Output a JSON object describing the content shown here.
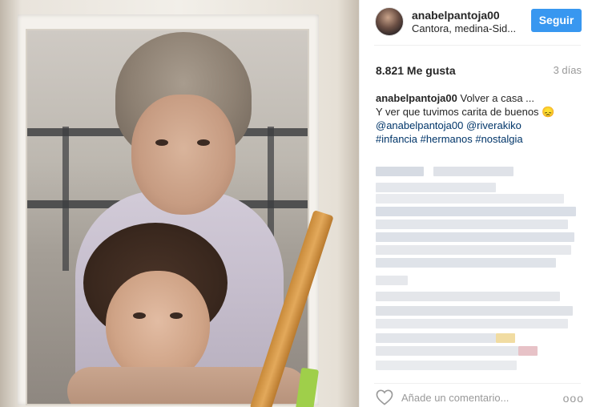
{
  "post": {
    "username": "anabelpantoja00",
    "location": "Cantora, medina-Sid...",
    "follow_label": "Seguir",
    "likes": "8.821 Me gusta",
    "time_ago": "3 días"
  },
  "caption": {
    "user": "anabelpantoja00",
    "line1": "Volver a casa ...",
    "line2": "Y ver que tuvimos carita de buenos 😞",
    "mention1": "@anabelpantoja00",
    "mention2": "@riverakiko",
    "tag1": "#infancia",
    "tag2": "#hermanos",
    "tag3": "#nostalgia"
  },
  "comment": {
    "placeholder": "Añade un comentario...",
    "more_label": "ooo"
  },
  "icons": {
    "heart": "heart-icon",
    "more": "more-options-icon"
  },
  "colors": {
    "follow_button": "#3897f0",
    "link": "#003569",
    "muted": "#999999"
  }
}
